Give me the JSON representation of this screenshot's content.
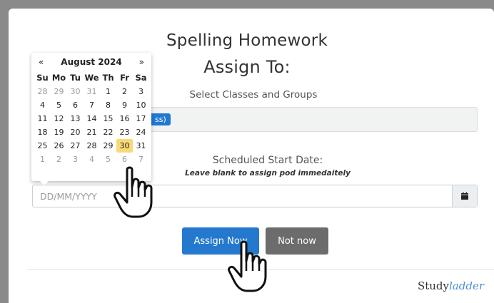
{
  "page": {
    "title": "Spelling Homework",
    "subtitle": "Assign To:",
    "select_classes_label": "Select Classes and Groups",
    "class_chip": "ss)",
    "schedule_label": "Scheduled Start Date:",
    "schedule_note": "Leave blank to assign pod immedaitely",
    "date_placeholder": "DD/MM/YYYY",
    "date_value": ""
  },
  "buttons": {
    "assign_now": "Assign Now",
    "not_now": "Not now"
  },
  "brand": {
    "part1": "Study",
    "part2": "ladder"
  },
  "calendar": {
    "prev": "«",
    "next": "»",
    "month_label": "August 2024",
    "weekdays": [
      "Su",
      "Mo",
      "Tu",
      "We",
      "Th",
      "Fr",
      "Sa"
    ],
    "weeks": [
      [
        "28",
        "29",
        "30",
        "31",
        "1",
        "2",
        "3"
      ],
      [
        "4",
        "5",
        "6",
        "7",
        "8",
        "9",
        "10"
      ],
      [
        "11",
        "12",
        "13",
        "14",
        "15",
        "16",
        "17"
      ],
      [
        "18",
        "19",
        "20",
        "21",
        "22",
        "23",
        "24"
      ],
      [
        "25",
        "26",
        "27",
        "28",
        "29",
        "30",
        "31"
      ],
      [
        "1",
        "2",
        "3",
        "4",
        "5",
        "6",
        "7"
      ]
    ],
    "selected": "30",
    "colors": {
      "selected_bg": "#f8d978",
      "accent": "#2479cf"
    }
  },
  "icons": {
    "calendar": "calendar-icon",
    "pointer": "hand-pointer-icon"
  }
}
